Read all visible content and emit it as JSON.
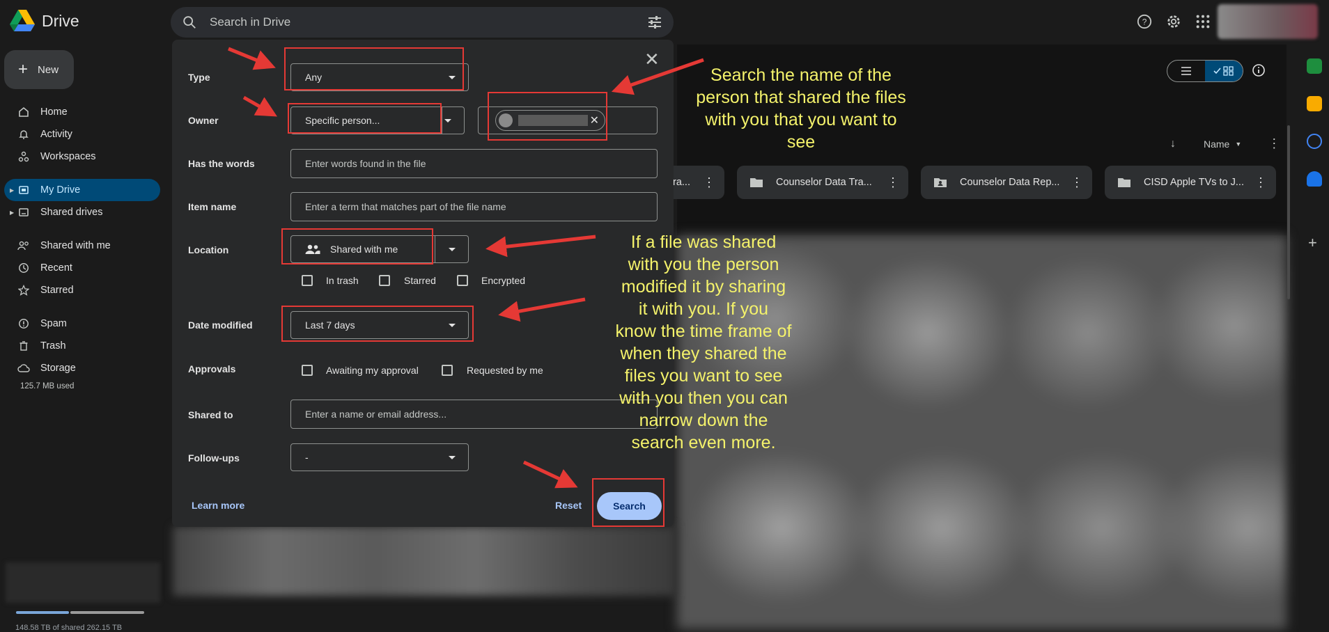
{
  "app": {
    "name": "Drive"
  },
  "search": {
    "placeholder": "Search in Drive"
  },
  "sidebar": {
    "new_label": "New",
    "items": [
      {
        "label": "Home",
        "icon": "home-icon"
      },
      {
        "label": "Activity",
        "icon": "bell-icon"
      },
      {
        "label": "Workspaces",
        "icon": "workspaces-icon"
      },
      {
        "label": "My Drive",
        "icon": "my-drive-icon",
        "active": true
      },
      {
        "label": "Shared drives",
        "icon": "shared-drives-icon"
      },
      {
        "label": "Shared with me",
        "icon": "people-icon"
      },
      {
        "label": "Recent",
        "icon": "clock-icon"
      },
      {
        "label": "Starred",
        "icon": "star-icon"
      },
      {
        "label": "Spam",
        "icon": "spam-icon"
      },
      {
        "label": "Trash",
        "icon": "trash-icon"
      },
      {
        "label": "Storage",
        "icon": "cloud-icon"
      }
    ],
    "storage_used": "125.7 MB used",
    "storage_bottom": "148.58 TB of shared 262.15 TB"
  },
  "content": {
    "sort_label": "Name",
    "folders": [
      {
        "name": "ra...",
        "icon": "folder-icon"
      },
      {
        "name": "Counselor Data Tra...",
        "icon": "folder-icon"
      },
      {
        "name": "Counselor Data Rep...",
        "icon": "shared-folder-icon"
      },
      {
        "name": "CISD Apple TVs to J...",
        "icon": "folder-icon"
      }
    ]
  },
  "dialog": {
    "type": {
      "label": "Type",
      "value": "Any"
    },
    "owner": {
      "label": "Owner",
      "value": "Specific person..."
    },
    "has_words": {
      "label": "Has the words",
      "placeholder": "Enter words found in the file"
    },
    "item_name": {
      "label": "Item name",
      "placeholder": "Enter a term that matches part of the file name"
    },
    "location": {
      "label": "Location",
      "value": "Shared with me",
      "checkboxes": [
        "In trash",
        "Starred",
        "Encrypted"
      ]
    },
    "date_modified": {
      "label": "Date modified",
      "value": "Last 7 days"
    },
    "approvals": {
      "label": "Approvals",
      "checkboxes": [
        "Awaiting my approval",
        "Requested by me"
      ]
    },
    "shared_to": {
      "label": "Shared to",
      "placeholder": "Enter a name or email address..."
    },
    "follow_ups": {
      "label": "Follow-ups",
      "value": "-"
    },
    "learn_more": "Learn more",
    "reset": "Reset",
    "search": "Search"
  },
  "annotations": {
    "note1": [
      "Search the name of the",
      "person that shared the files",
      "with you that you want to",
      "see"
    ],
    "note2": [
      "If a file was shared",
      "with you the person",
      "modified it by sharing",
      "it with you.  If you",
      "know the time frame of",
      "when they shared the",
      "files you want to see",
      "with you then you can",
      "narrow down the",
      "search even more."
    ],
    "highlight_color": "#e53935",
    "text_color": "#f4f26b"
  }
}
